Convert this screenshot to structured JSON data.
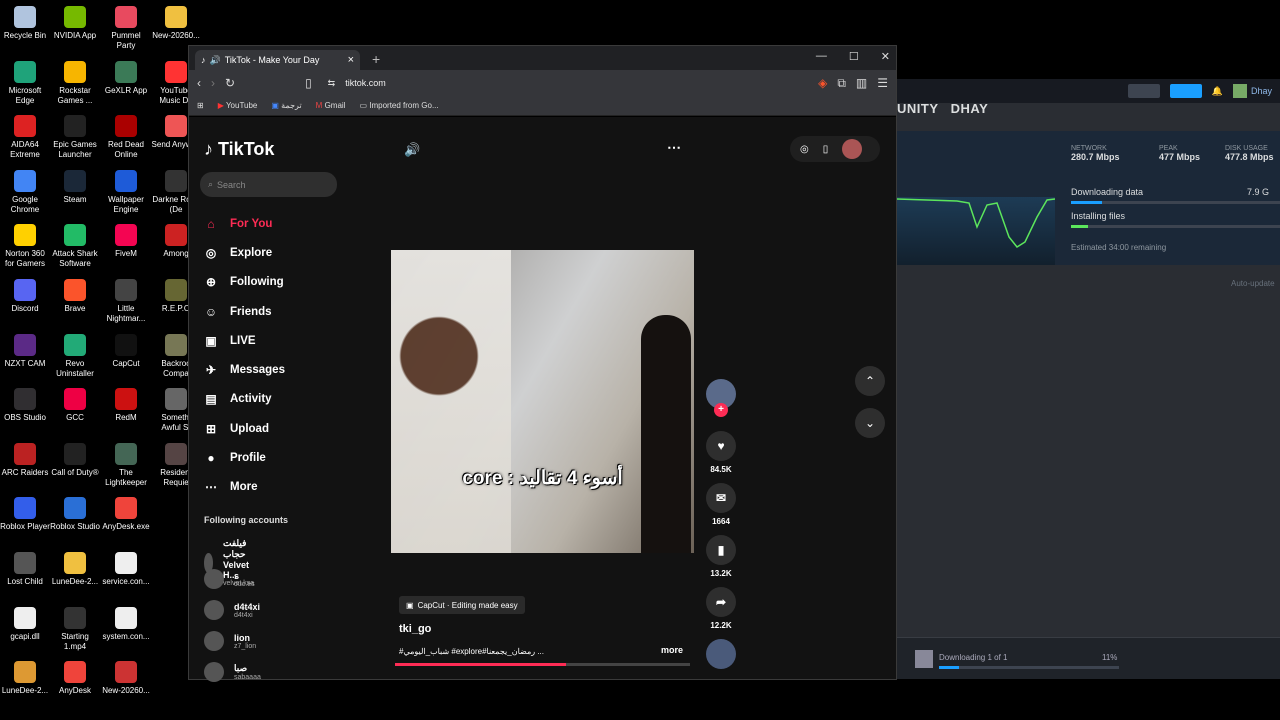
{
  "desktop_icons": [
    {
      "label": "Recycle Bin",
      "color": "#b0c4de"
    },
    {
      "label": "NVIDIA App",
      "color": "#76b900"
    },
    {
      "label": "Pummel Party",
      "color": "#e84a5f"
    },
    {
      "label": "New-20260...",
      "color": "#f0c040"
    },
    {
      "label": "Microsoft Edge",
      "color": "#1fa37a"
    },
    {
      "label": "Rockstar Games ...",
      "color": "#f7b500"
    },
    {
      "label": "GeXLR App",
      "color": "#3b7a57"
    },
    {
      "label": "YouTube Music De",
      "color": "#ff3333"
    },
    {
      "label": "AIDA64 Extreme",
      "color": "#d22"
    },
    {
      "label": "Epic Games Launcher",
      "color": "#222"
    },
    {
      "label": "Red Dead Online",
      "color": "#a00"
    },
    {
      "label": "Send Anywhe",
      "color": "#e55"
    },
    {
      "label": "Google Chrome",
      "color": "#4285f4"
    },
    {
      "label": "Steam",
      "color": "#1b2838"
    },
    {
      "label": "Wallpaper Engine",
      "color": "#1e5bd8"
    },
    {
      "label": "Darkne Road (De",
      "color": "#333"
    },
    {
      "label": "Norton 360 for Gamers",
      "color": "#ffd000"
    },
    {
      "label": "Attack Shark Software",
      "color": "#2b6"
    },
    {
      "label": "FiveM",
      "color": "#f40552"
    },
    {
      "label": "Among",
      "color": "#c22"
    },
    {
      "label": "Discord",
      "color": "#5865f2"
    },
    {
      "label": "Brave",
      "color": "#fb542b"
    },
    {
      "label": "Little Nightmar...",
      "color": "#444"
    },
    {
      "label": "R.E.P.O",
      "color": "#663"
    },
    {
      "label": "NZXT CAM",
      "color": "#5b2a86"
    },
    {
      "label": "Revo Uninstaller",
      "color": "#2a7"
    },
    {
      "label": "CapCut",
      "color": "#111"
    },
    {
      "label": "Backroo Compa",
      "color": "#775"
    },
    {
      "label": "OBS Studio",
      "color": "#302e31"
    },
    {
      "label": "GCC",
      "color": "#e04"
    },
    {
      "label": "RedM",
      "color": "#c11"
    },
    {
      "label": "Somethi Awful St",
      "color": "#666"
    },
    {
      "label": "ARC Raiders",
      "color": "#b22"
    },
    {
      "label": "Call of Duty®",
      "color": "#222"
    },
    {
      "label": "The Lightkeeper",
      "color": "#465"
    },
    {
      "label": "Resident Requie",
      "color": "#544"
    },
    {
      "label": "Roblox Player",
      "color": "#335eea"
    },
    {
      "label": "Roblox Studio",
      "color": "#2a6fd6"
    },
    {
      "label": "AnyDesk.exe",
      "color": "#ef443b"
    },
    {
      "label": "Lost Child",
      "color": "#555"
    },
    {
      "label": "LuneDee-2...",
      "color": "#f0c040"
    },
    {
      "label": "service.con...",
      "color": "#eee"
    },
    {
      "label": "gcapi.dll",
      "color": "#eee"
    },
    {
      "label": "Starting 1.mp4",
      "color": "#333"
    },
    {
      "label": "system.con...",
      "color": "#eee"
    },
    {
      "label": "LuneDee-2...",
      "color": "#d93"
    },
    {
      "label": "AnyDesk",
      "color": "#ef443b"
    },
    {
      "label": "New-20260...",
      "color": "#c33"
    }
  ],
  "steam": {
    "nav": [
      "UNITY",
      "DHAY"
    ],
    "user": "Dhay",
    "stats": [
      {
        "label": "NETWORK",
        "value": "280.7 Mbps"
      },
      {
        "label": "PEAK",
        "value": "477 Mbps"
      },
      {
        "label": "DISK USAGE",
        "value": "477.8 Mbps"
      }
    ],
    "downloading": "Downloading data",
    "downloading_size": "7.9 G",
    "installing": "Installing files",
    "eta": "Estimated 34:00 remaining",
    "auto": "Auto-update",
    "footer": "Downloading 1 of 1",
    "footer_pct": "11%"
  },
  "browser": {
    "tab_title": "TikTok - Make Your Day",
    "url": "tiktok.com",
    "bookmarks": [
      "YouTube",
      "ترجمة",
      "Gmail",
      "Imported from Go..."
    ]
  },
  "tiktok": {
    "logo": "TikTok",
    "search_placeholder": "Search",
    "nav": [
      {
        "label": "For You",
        "icon": "⌂",
        "active": true
      },
      {
        "label": "Explore",
        "icon": "◎"
      },
      {
        "label": "Following",
        "icon": "⊕"
      },
      {
        "label": "Friends",
        "icon": "☺"
      },
      {
        "label": "LIVE",
        "icon": "▣"
      },
      {
        "label": "Messages",
        "icon": "✈"
      },
      {
        "label": "Activity",
        "icon": "▤"
      },
      {
        "label": "Upload",
        "icon": "⊞"
      },
      {
        "label": "Profile",
        "icon": "●"
      },
      {
        "label": "More",
        "icon": "⋯"
      }
    ],
    "following_header": "Following accounts",
    "accounts": [
      {
        "name": "فيلفت حجاب Velvet H...",
        "handle": "velvet.ksa"
      },
      {
        "name": "s",
        "handle": "ouc.es"
      },
      {
        "name": "d4t4xi",
        "handle": "d4t4xi"
      },
      {
        "name": "lion",
        "handle": "z7_lion"
      },
      {
        "name": "صبا",
        "handle": "sabaaaa"
      }
    ],
    "caption": "core : أسوء 4 تقاليد",
    "likes": "84.5K",
    "comments": "1664",
    "saves": "13.2K",
    "shares": "12.2K",
    "capcut": "CapCut · Editing made easy",
    "author": "tki_go",
    "desc": "#شباب_اليومي #explore#رمضان_يجمعنا ...",
    "more": "more"
  }
}
